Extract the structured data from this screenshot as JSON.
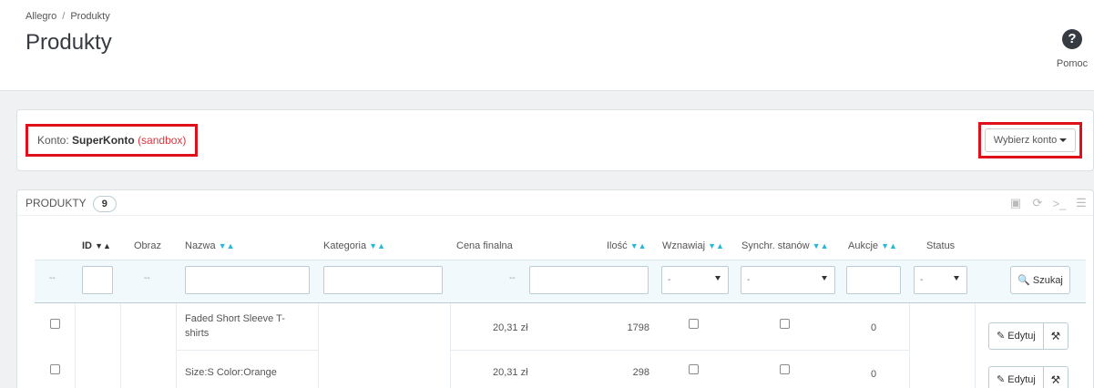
{
  "breadcrumb": {
    "parent": "Allegro",
    "separator": "/",
    "current": "Produkty"
  },
  "page_title": "Produkty",
  "help": {
    "icon": "question-circle-icon",
    "label": "Pomoc"
  },
  "account": {
    "prefix": "Konto:",
    "name": "SuperKonto",
    "mode": "(sandbox)",
    "choose_label": "Wybierz konto"
  },
  "list": {
    "title": "PRODUKTY",
    "count": "9",
    "toolbar_icons": [
      "export-icon",
      "refresh-icon",
      "sql-query-icon",
      "database-icon"
    ],
    "columns": {
      "id": "ID",
      "image": "Obraz",
      "name": "Nazwa",
      "category": "Kategoria",
      "final_price": "Cena finalna",
      "quantity": "Ilość",
      "renew": "Wznawiaj",
      "sync_stock": "Synchr. stanów",
      "auctions": "Aukcje",
      "status": "Status"
    },
    "filters": {
      "empty_dash": "--",
      "select_default": "-",
      "search_label": "Szukaj"
    },
    "rows": [
      {
        "name": "Faded Short Sleeve T-shirts",
        "price": "20,31 zł",
        "quantity": "1798",
        "auctions": "0",
        "edit_label": "Edytuj"
      },
      {
        "name": "Size:S Color:Orange",
        "price": "20,31 zł",
        "quantity": "298",
        "auctions": "0",
        "edit_label": "Edytuj"
      }
    ]
  },
  "colors": {
    "accent": "#25b9d7",
    "highlight_border": "#e0101a",
    "sandbox": "#d9363e"
  }
}
